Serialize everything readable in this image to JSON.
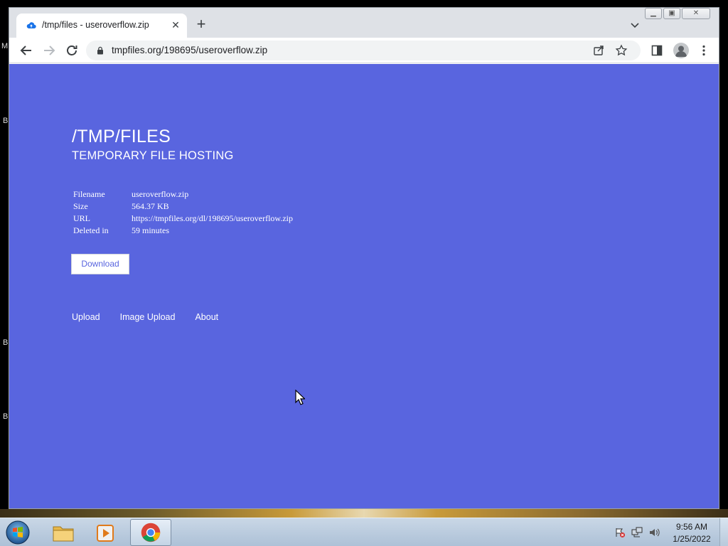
{
  "browser": {
    "tab_title": "/tmp/files - useroverflow.zip",
    "url": "tmpfiles.org/198695/useroverflow.zip"
  },
  "page": {
    "title": "/TMP/FILES",
    "subtitle": "TEMPORARY FILE HOSTING",
    "file_info": [
      {
        "label": "Filename",
        "value": "useroverflow.zip"
      },
      {
        "label": "Size",
        "value": "564.37 KB"
      },
      {
        "label": "URL",
        "value": "https://tmpfiles.org/dl/198695/useroverflow.zip"
      },
      {
        "label": "Deleted in",
        "value": "59 minutes"
      }
    ],
    "download_label": "Download",
    "nav": [
      "Upload",
      "Image Upload",
      "About"
    ]
  },
  "taskbar": {
    "time": "9:56 AM",
    "date": "1/25/2022"
  },
  "desktop_letters": [
    "M",
    "B",
    "B",
    "B"
  ],
  "colors": {
    "page_bg": "#5965df",
    "tab_strip": "#dee1e6"
  },
  "icons": {
    "favicon": "cloud-upload-icon",
    "tab_close": "close-icon",
    "new_tab": "plus-icon",
    "tab_search": "chevron-down-icon",
    "back": "arrow-left-icon",
    "forward": "arrow-right-icon",
    "reload": "reload-icon",
    "lock": "lock-icon",
    "share": "share-icon",
    "bookmark": "star-icon",
    "side_panel": "side-panel-icon",
    "profile": "profile-icon",
    "menu": "kebab-menu-icon"
  }
}
